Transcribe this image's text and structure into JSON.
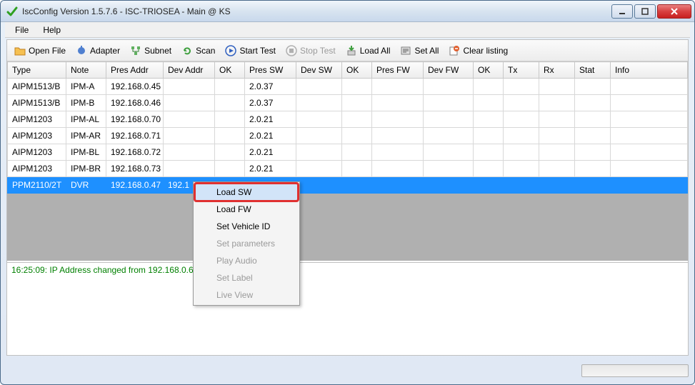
{
  "window": {
    "title": "IscConfig Version 1.5.7.6 - ISC-TRIOSEA - Main @ KS"
  },
  "menu": {
    "file": "File",
    "help": "Help"
  },
  "toolbar": {
    "open_file": "Open File",
    "adapter": "Adapter",
    "subnet": "Subnet",
    "scan": "Scan",
    "start_test": "Start Test",
    "stop_test": "Stop Test",
    "load_all": "Load All",
    "set_all": "Set All",
    "clear_listing": "Clear listing"
  },
  "columns": {
    "type": "Type",
    "note": "Note",
    "pres_addr": "Pres Addr",
    "dev_addr": "Dev Addr",
    "ok1": "OK",
    "pres_sw": "Pres SW",
    "dev_sw": "Dev SW",
    "ok2": "OK",
    "pres_fw": "Pres FW",
    "dev_fw": "Dev FW",
    "ok3": "OK",
    "tx": "Tx",
    "rx": "Rx",
    "stat": "Stat",
    "info": "Info"
  },
  "rows": [
    {
      "type": "AIPM1513/B",
      "note": "IPM-A",
      "pres_addr": "192.168.0.45",
      "dev_addr": "",
      "ok1": "",
      "pres_sw": "2.0.37",
      "dev_sw": "",
      "ok2": "",
      "pres_fw": "",
      "dev_fw": "",
      "ok3": "",
      "tx": "",
      "rx": "",
      "stat": "",
      "info": ""
    },
    {
      "type": "AIPM1513/B",
      "note": "IPM-B",
      "pres_addr": "192.168.0.46",
      "dev_addr": "",
      "ok1": "",
      "pres_sw": "2.0.37",
      "dev_sw": "",
      "ok2": "",
      "pres_fw": "",
      "dev_fw": "",
      "ok3": "",
      "tx": "",
      "rx": "",
      "stat": "",
      "info": ""
    },
    {
      "type": "AIPM1203",
      "note": "IPM-AL",
      "pres_addr": "192.168.0.70",
      "dev_addr": "",
      "ok1": "",
      "pres_sw": "2.0.21",
      "dev_sw": "",
      "ok2": "",
      "pres_fw": "",
      "dev_fw": "",
      "ok3": "",
      "tx": "",
      "rx": "",
      "stat": "",
      "info": ""
    },
    {
      "type": "AIPM1203",
      "note": "IPM-AR",
      "pres_addr": "192.168.0.71",
      "dev_addr": "",
      "ok1": "",
      "pres_sw": "2.0.21",
      "dev_sw": "",
      "ok2": "",
      "pres_fw": "",
      "dev_fw": "",
      "ok3": "",
      "tx": "",
      "rx": "",
      "stat": "",
      "info": ""
    },
    {
      "type": "AIPM1203",
      "note": "IPM-BL",
      "pres_addr": "192.168.0.72",
      "dev_addr": "",
      "ok1": "",
      "pres_sw": "2.0.21",
      "dev_sw": "",
      "ok2": "",
      "pres_fw": "",
      "dev_fw": "",
      "ok3": "",
      "tx": "",
      "rx": "",
      "stat": "",
      "info": ""
    },
    {
      "type": "AIPM1203",
      "note": "IPM-BR",
      "pres_addr": "192.168.0.73",
      "dev_addr": "",
      "ok1": "",
      "pres_sw": "2.0.21",
      "dev_sw": "",
      "ok2": "",
      "pres_fw": "",
      "dev_fw": "",
      "ok3": "",
      "tx": "",
      "rx": "",
      "stat": "",
      "info": ""
    },
    {
      "type": "PPM2110/2T",
      "note": "DVR",
      "pres_addr": "192.168.0.47",
      "dev_addr": "192.1",
      "ok1": "",
      "pres_sw": "",
      "dev_sw": "",
      "ok2": "",
      "pres_fw": "",
      "dev_fw": "",
      "ok3": "",
      "tx": "",
      "rx": "",
      "stat": "",
      "info": "",
      "selected": true
    }
  ],
  "context_menu": {
    "load_sw": "Load SW",
    "load_fw": "Load FW",
    "set_vehicle_id": "Set Vehicle ID",
    "set_parameters": "Set parameters",
    "play_audio": "Play Audio",
    "set_label": "Set Label",
    "live_view": "Live View"
  },
  "log": {
    "line1": "16:25:09: IP Address changed from 192.168.0.60"
  }
}
